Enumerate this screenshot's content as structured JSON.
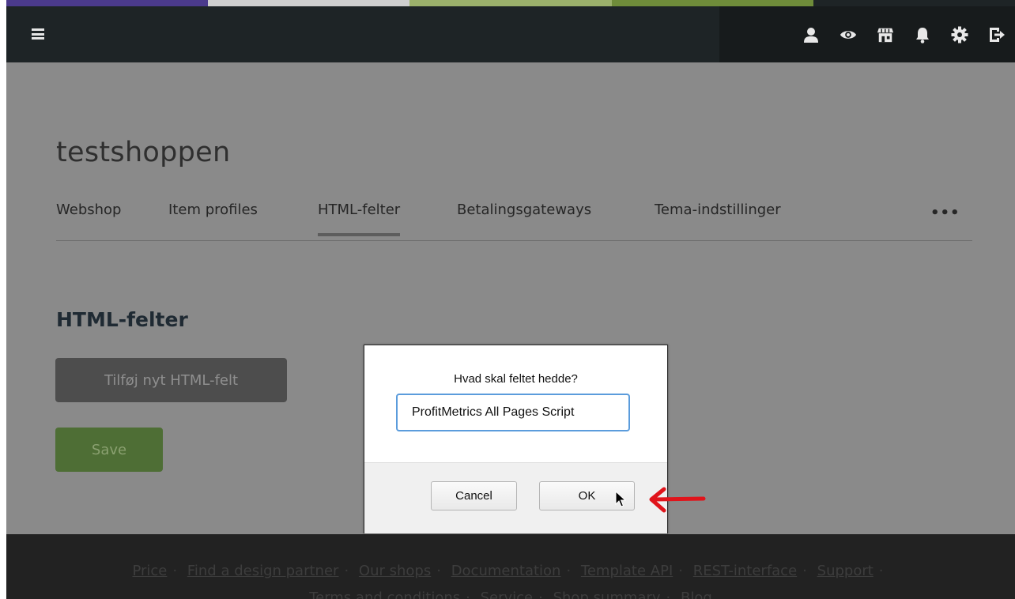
{
  "stripes": [
    "#4b3a8c",
    "#cfcfcf",
    "#9bb06b",
    "#6f8c3a",
    "#1e2426"
  ],
  "header": {
    "icons": [
      "user-icon",
      "eye-icon",
      "store-icon",
      "bell-icon",
      "gear-icon",
      "sign-out-icon"
    ]
  },
  "shop": {
    "title": "testshoppen"
  },
  "tabs": [
    {
      "label": "Webshop",
      "active": false
    },
    {
      "label": "Item profiles",
      "active": false
    },
    {
      "label": "HTML-felter",
      "active": true
    },
    {
      "label": "Betalingsgateways",
      "active": false
    },
    {
      "label": "Tema-indstillinger",
      "active": false
    }
  ],
  "more_label": "•••",
  "section": {
    "title": "HTML-felter",
    "add_button": "Tilføj nyt HTML-felt",
    "save_button": "Save"
  },
  "dialog": {
    "prompt": "Hvad skal feltet hedde?",
    "input_value": "ProfitMetrics All Pages Script",
    "cancel_label": "Cancel",
    "ok_label": "OK"
  },
  "footer": {
    "links": [
      "Price",
      "Find a design partner",
      "Our shops",
      "Documentation",
      "Template API",
      "REST-interface",
      "Support"
    ],
    "row2": [
      "Terms and conditions",
      "Service",
      "Shop summary",
      "Blog"
    ]
  },
  "colors": {
    "accent_arrow": "#e0141b",
    "input_focus": "#5b9cdc",
    "save_button": "#4e6e35"
  }
}
